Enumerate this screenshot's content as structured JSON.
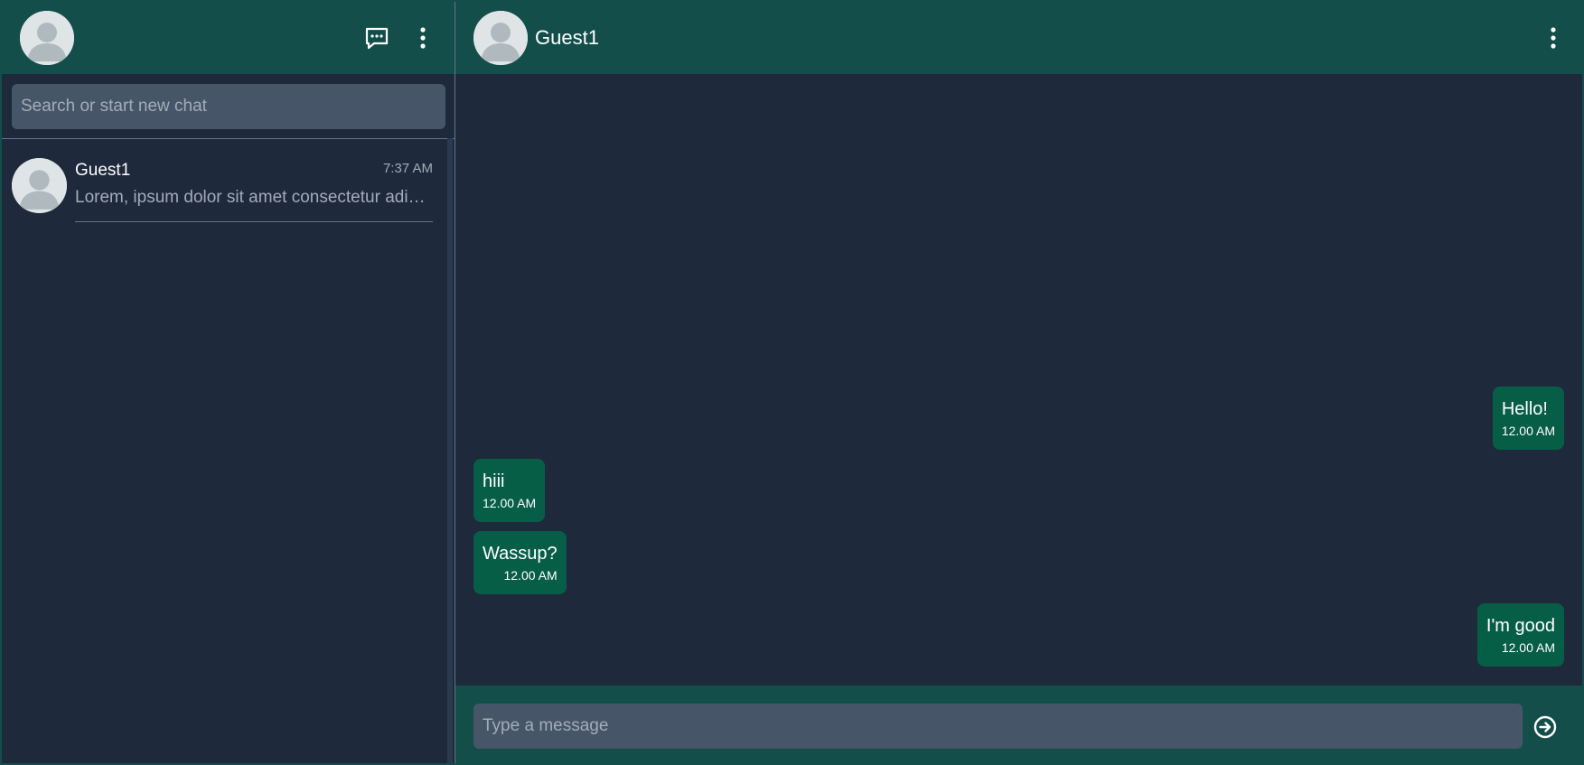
{
  "sidebar": {
    "header": {
      "avatar_icon": "user-avatar-icon",
      "new_chat_icon": "chat-dots-icon",
      "menu_icon": "kebab-menu-icon"
    },
    "search": {
      "placeholder": "Search or start new chat",
      "value": ""
    },
    "chats": [
      {
        "name": "Guest1",
        "time": "7:37 AM",
        "preview": "Lorem, ipsum dolor sit amet consectetur adipisicing elit."
      }
    ]
  },
  "conversation": {
    "header": {
      "contact_name": "Guest1",
      "avatar_icon": "user-avatar-icon",
      "menu_icon": "kebab-menu-icon"
    },
    "messages": [
      {
        "direction": "outgoing",
        "text": "Hello!",
        "time": "12.00 AM"
      },
      {
        "direction": "incoming",
        "text": "hiii",
        "time": "12.00 AM"
      },
      {
        "direction": "incoming",
        "text": "Wassup?",
        "time": "12.00 AM"
      },
      {
        "direction": "outgoing",
        "text": "I'm good",
        "time": "12.00 AM"
      }
    ],
    "composer": {
      "placeholder": "Type a message",
      "value": "",
      "send_icon": "send-arrow-icon"
    }
  },
  "colors": {
    "header": "#134e4a",
    "background": "#1e293b",
    "input": "#475569",
    "bubble": "#075e47",
    "muted_text": "#a3acb8",
    "divider": "#64748b"
  }
}
